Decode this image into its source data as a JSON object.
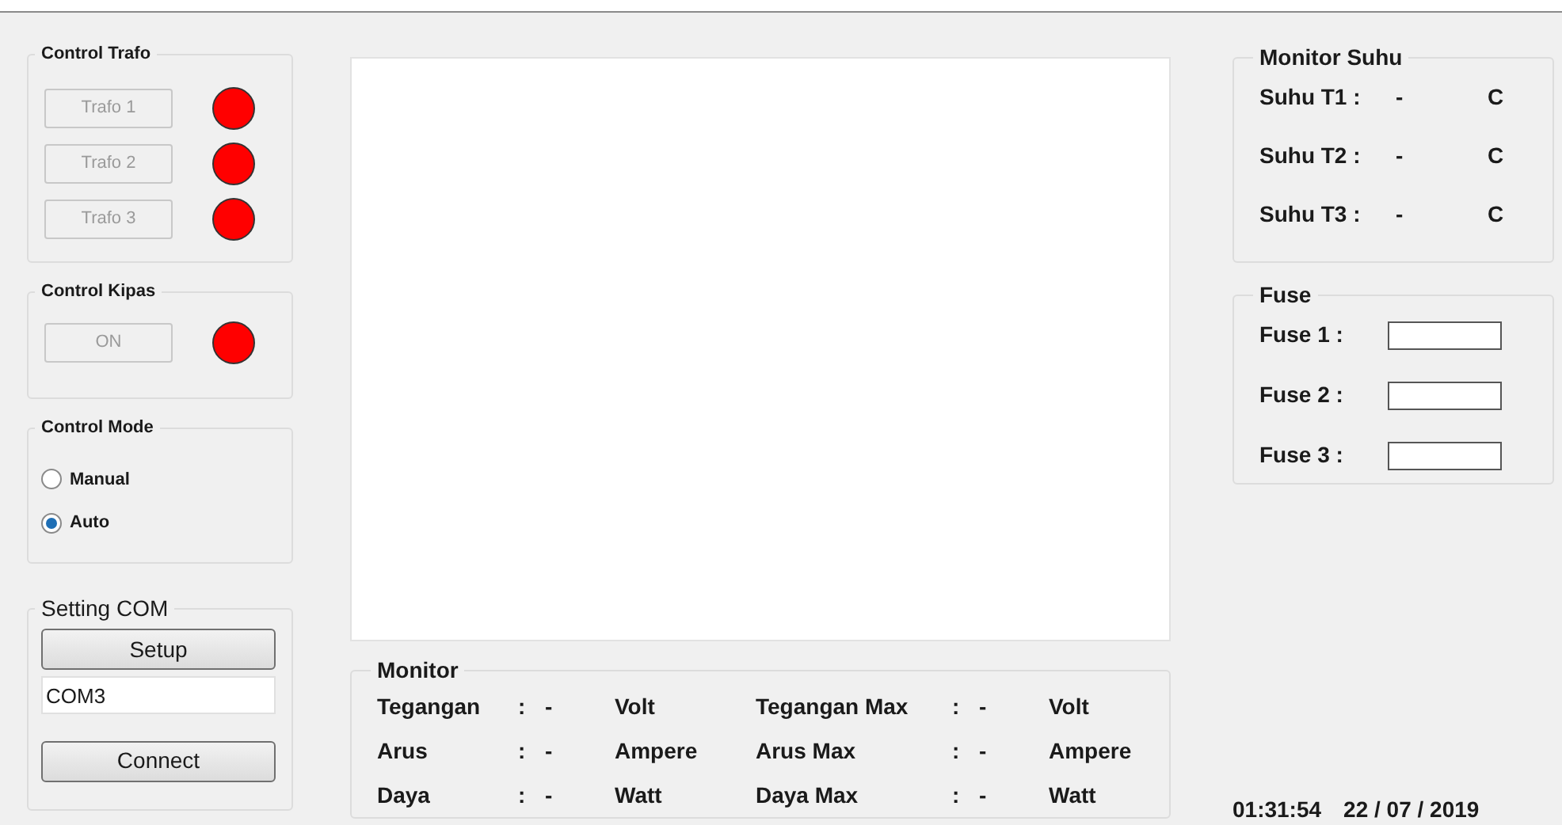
{
  "control_trafo": {
    "title": "Control Trafo",
    "items": [
      {
        "label": "Trafo 1",
        "disabled": true,
        "color": "#ff0000"
      },
      {
        "label": "Trafo 2",
        "disabled": true,
        "color": "#ff0000"
      },
      {
        "label": "Trafo 3",
        "disabled": true,
        "color": "#ff0000"
      }
    ]
  },
  "control_kipas": {
    "title": "Control Kipas",
    "items": [
      {
        "label": "ON",
        "disabled": true,
        "color": "#ff0000"
      }
    ]
  },
  "control_mode": {
    "title": "Control Mode",
    "options": [
      {
        "label": "Manual",
        "selected": false
      },
      {
        "label": "Auto",
        "selected": true
      }
    ]
  },
  "setting_com": {
    "title": "Setting COM",
    "setup_button": "Setup",
    "port_field": "COM3",
    "connect_button": "Connect"
  },
  "monitor": {
    "title": "Monitor",
    "rows": [
      {
        "label": "Tegangan",
        "colon": ":",
        "value": "-",
        "unit": "Volt"
      },
      {
        "label": "Tegangan Max",
        "colon": ":",
        "value": "-",
        "unit": "Volt"
      },
      {
        "label": "Arus",
        "colon": ":",
        "value": "-",
        "unit": "Ampere"
      },
      {
        "label": "Arus Max",
        "colon": ":",
        "value": "-",
        "unit": "Ampere"
      },
      {
        "label": "Daya",
        "colon": ":",
        "value": "-",
        "unit": "Watt"
      },
      {
        "label": "Daya Max",
        "colon": ":",
        "value": "-",
        "unit": "Watt"
      }
    ]
  },
  "monitor_suhu": {
    "title": "Monitor Suhu",
    "rows": [
      {
        "label": "Suhu T1 :",
        "value": "-",
        "unit": "C"
      },
      {
        "label": "Suhu T2 :",
        "value": "-",
        "unit": "C"
      },
      {
        "label": "Suhu T3 :",
        "value": "-",
        "unit": "C"
      }
    ]
  },
  "fuse": {
    "title": "Fuse",
    "rows": [
      {
        "label": "Fuse 1 :"
      },
      {
        "label": "Fuse 2 :"
      },
      {
        "label": "Fuse 3 :"
      }
    ]
  },
  "clock": {
    "time": "01:31:54",
    "date": "22 / 07 / 2019"
  }
}
